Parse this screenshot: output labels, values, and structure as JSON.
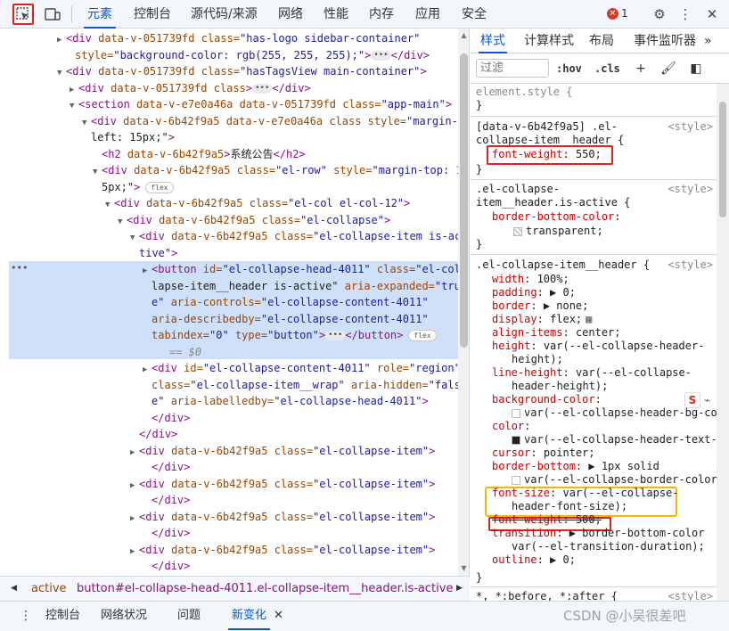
{
  "toolbar": {
    "tabs": [
      "元素",
      "控制台",
      "源代码/来源",
      "网络",
      "性能",
      "内存",
      "应用",
      "安全"
    ],
    "active_tab": "元素",
    "error_count": "1",
    "icons": [
      "inspect-icon",
      "device-toggle-icon",
      "error-icon",
      "gear-icon",
      "kebab-menu-icon",
      "close-icon"
    ]
  },
  "elements": {
    "lines": [
      {
        "parts": [
          "▶",
          "<div ",
          "data-v-051739fd ",
          "class=",
          "\"has-logo sidebar-container\""
        ]
      },
      {
        "parts": [
          "",
          "style=",
          "\"background-color: rgb(255, 255, 255);\"",
          ">",
          "</div>"
        ]
      },
      {
        "parts": [
          "▼",
          "<div ",
          "data-v-051739fd ",
          "class=",
          "\"hasTagsView main-container\"",
          ">"
        ]
      },
      {
        "parts": [
          "▶",
          "<div ",
          "data-v-051739fd ",
          "class",
          ">",
          "</div>"
        ]
      },
      {
        "parts": [
          "▼",
          "<section ",
          "data-v-e7e0a46a ",
          "data-v-051739fd ",
          "class=",
          "\"app-main\"",
          ">"
        ]
      },
      {
        "parts": [
          "▼",
          "<div ",
          "data-v-6b42f9a5 ",
          "data-v-e7e0a46a ",
          "class ",
          "style=",
          "\"margin-"
        ]
      },
      {
        "parts": [
          "",
          "left: 15px;\"",
          ">"
        ]
      },
      {
        "parts": [
          "",
          "<h2 ",
          "data-v-6b42f9a5",
          ">",
          "系统公告",
          "</h2>"
        ]
      },
      {
        "parts": [
          "▼",
          "<div ",
          "data-v-6b42f9a5 ",
          "class=",
          "\"el-row\" ",
          "style=",
          "\"margin-top: 1"
        ]
      },
      {
        "parts": [
          "",
          "5px;\"",
          ">",
          "flex"
        ]
      },
      {
        "parts": [
          "▼",
          "<div ",
          "data-v-6b42f9a5 ",
          "class=",
          "\"el-col el-col-12\"",
          ">"
        ]
      },
      {
        "parts": [
          "▼",
          "<div ",
          "data-v-6b42f9a5 ",
          "class=",
          "\"el-collapse\"",
          ">"
        ]
      },
      {
        "parts": [
          "▼",
          "<div ",
          "data-v-6b42f9a5 ",
          "class=",
          "\"el-collapse-item is-ac"
        ]
      },
      {
        "parts": [
          "",
          "tive\"",
          ">"
        ]
      },
      {
        "parts": [
          "▶",
          "<button ",
          "id=",
          "\"el-collapse-head-4011\" ",
          "class=",
          "\"el-col"
        ]
      },
      {
        "parts": [
          "",
          "lapse-item__header is-active\" ",
          "aria-expanded=",
          "\"tru"
        ]
      },
      {
        "parts": [
          "",
          "e\" ",
          "aria-controls=",
          "\"el-collapse-content-4011\""
        ]
      },
      {
        "parts": [
          "",
          "aria-describedby=",
          "\"el-collapse-content-4011\""
        ]
      },
      {
        "parts": [
          "",
          "tabindex=",
          "\"0\" ",
          "type=",
          "\"button\"",
          ">",
          "</button>",
          "flex"
        ]
      },
      {
        "parts": [
          "",
          "== $0"
        ]
      },
      {
        "parts": [
          "▶",
          "<div ",
          "id=",
          "\"el-collapse-content-4011\" ",
          "role=",
          "\"region\""
        ]
      },
      {
        "parts": [
          "",
          "class=",
          "\"el-collapse-item__wrap\" ",
          "aria-hidden=",
          "\"fals"
        ]
      },
      {
        "parts": [
          "",
          "e\" ",
          "aria-labelledby=",
          "\"el-collapse-head-4011\"",
          ">"
        ]
      },
      {
        "parts": [
          "",
          "</div>"
        ]
      },
      {
        "parts": [
          "",
          "</div>"
        ]
      },
      {
        "parts": [
          "▶",
          "<div ",
          "data-v-6b42f9a5 ",
          "class=",
          "\"el-collapse-item\"",
          ">"
        ]
      },
      {
        "parts": [
          "",
          "</div>"
        ]
      },
      {
        "parts": [
          "▶",
          "<div ",
          "data-v-6b42f9a5 ",
          "class=",
          "\"el-collapse-item\"",
          ">"
        ]
      },
      {
        "parts": [
          "",
          "</div>"
        ]
      },
      {
        "parts": [
          "▶",
          "<div ",
          "data-v-6b42f9a5 ",
          "class=",
          "\"el-collapse-item\"",
          ">"
        ]
      },
      {
        "parts": [
          "",
          "</div>"
        ]
      },
      {
        "parts": [
          "▶",
          "<div ",
          "data-v-6b42f9a5 ",
          "class=",
          "\"el-collapse-item\"",
          ">"
        ]
      },
      {
        "parts": [
          "",
          "</div>"
        ]
      }
    ],
    "selected_marker": "== $0"
  },
  "breadcrumb": {
    "prev": "◀",
    "item_a": "active",
    "item_b": "button#el-collapse-head-4011.el-collapse-item__header.is-active",
    "next": "▶"
  },
  "styles": {
    "tabs": [
      "样式",
      "计算样式",
      "布局",
      "事件监听器"
    ],
    "active_tab": "样式",
    "more": "»",
    "filter_placeholder": "过滤",
    "hov": ":hov",
    "cls": ".cls",
    "element_style": "element.style {",
    "close": "}",
    "rule1": {
      "selector_a": "[data-v-6b42f9a5] .el-",
      "selector_b": "collapse-item__header {",
      "origin": "<style>",
      "prop": "font-weight",
      "value": "550;"
    },
    "rule2": {
      "selector_a": ".el-collapse-",
      "selector_b": "item__header.is-active {",
      "origin": "<style>",
      "prop": "border-bottom-color",
      "value": "transparent;"
    },
    "rule3": {
      "selector": ".el-collapse-item__header {",
      "origin": "<style>",
      "decls": [
        {
          "p": "width",
          "v": "100%;"
        },
        {
          "p": "padding",
          "v": "▶ 0;"
        },
        {
          "p": "border",
          "v": "▶ none;"
        },
        {
          "p": "display",
          "v": "flex;"
        },
        {
          "p": "align-items",
          "v": "center;"
        },
        {
          "p": "height",
          "v": "var(--el-collapse-header-"
        },
        {
          "p": "",
          "v": "height);"
        },
        {
          "p": "line-height",
          "v": "var(--el-collapse-"
        },
        {
          "p": "",
          "v": "header-height);"
        },
        {
          "p": "background-color",
          "v": ""
        },
        {
          "p": "",
          "v": "var(--el-collapse-header-bg-co"
        },
        {
          "p": "color",
          "v": ""
        },
        {
          "p": "",
          "v": "var(--el-collapse-header-text-"
        },
        {
          "p": "cursor",
          "v": "pointer;"
        },
        {
          "p": "border-bottom",
          "v": "▶ 1px solid"
        },
        {
          "p": "",
          "v": "var(--el-collapse-border-color"
        },
        {
          "p": "font-size",
          "v": "var(--el-collapse-"
        },
        {
          "p": "",
          "v": "header-font-size);"
        },
        {
          "p": "font-weight",
          "v": "500;"
        },
        {
          "p": "transition",
          "v": "▶ border-bottom-color"
        },
        {
          "p": "",
          "v": "var(--el-transition-duration);"
        },
        {
          "p": "outline",
          "v": "▶ 0;"
        }
      ]
    },
    "rule4": {
      "selector": "*, *:before, *:after {",
      "origin": "<style>"
    }
  },
  "drawer": {
    "tabs": [
      "控制台",
      "网络状况",
      "问题",
      "新变化"
    ],
    "active_tab": "新变化",
    "close": "✕"
  },
  "watermark": "CSDN @小吴很差吧"
}
